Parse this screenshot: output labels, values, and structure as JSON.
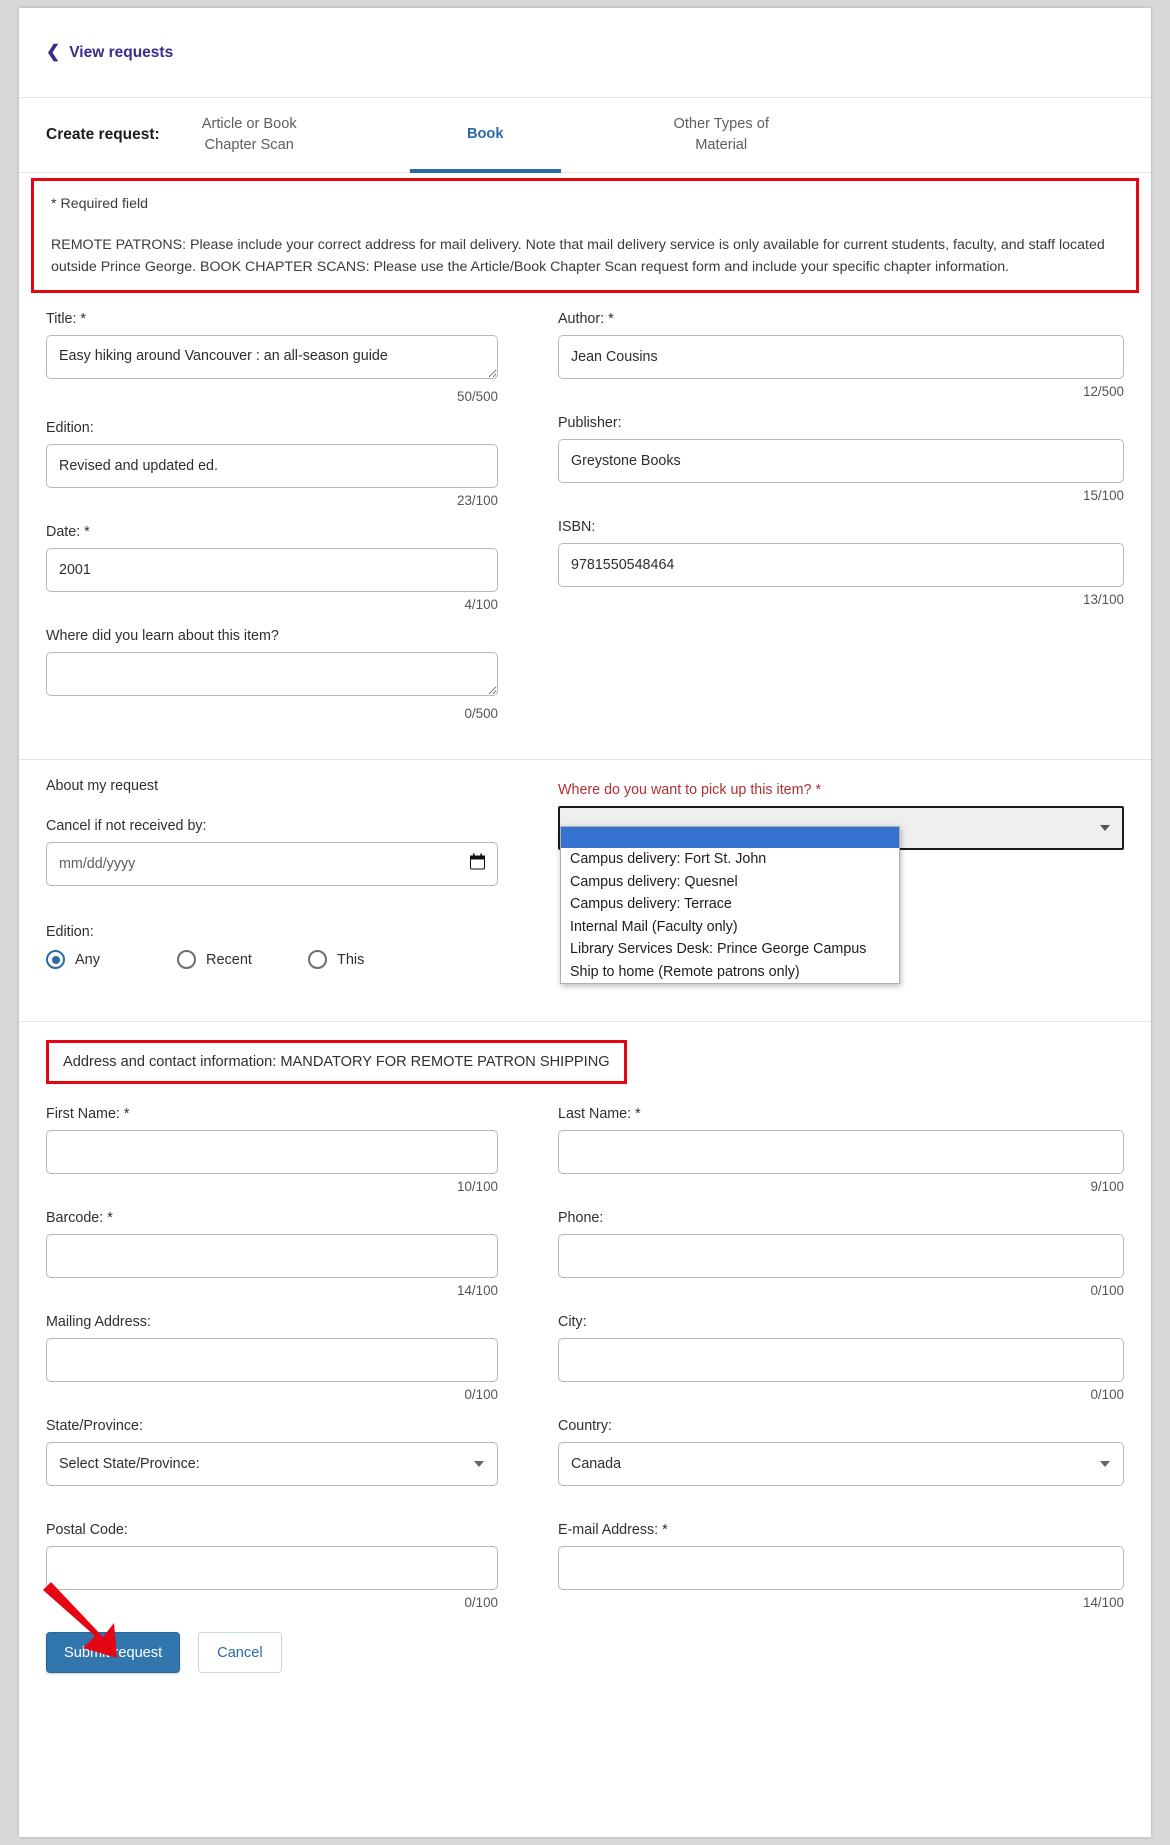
{
  "header": {
    "back_label": "View requests",
    "back_icon": "chevron-left-icon"
  },
  "tabs": {
    "group_label": "Create request:",
    "items": [
      {
        "label": "Article or Book Chapter Scan",
        "active": false
      },
      {
        "label": "Book",
        "active": true
      },
      {
        "label": "Other Types of Material",
        "active": false
      }
    ]
  },
  "notice": {
    "required_note": "* Required field",
    "text": "REMOTE PATRONS: Please include your correct address for mail delivery. Note that mail delivery service is only available for current students, faculty, and staff located outside Prince George. BOOK CHAPTER SCANS: Please use the Article/Book Chapter Scan request form and include your specific chapter information.",
    "border_color": "#e40613"
  },
  "item_details": {
    "title": {
      "label": "Title: *",
      "value": "Easy hiking around Vancouver : an all-season guide",
      "counter": "50/500"
    },
    "author": {
      "label": "Author: *",
      "value": "Jean Cousins",
      "counter": "12/500"
    },
    "edition": {
      "label": "Edition:",
      "value": "Revised and updated ed.",
      "counter": "23/100"
    },
    "publisher": {
      "label": "Publisher:",
      "value": "Greystone Books",
      "counter": "15/100"
    },
    "date": {
      "label": "Date: *",
      "value": "2001",
      "counter": "4/100"
    },
    "isbn": {
      "label": "ISBN:",
      "value": "9781550548464",
      "counter": "13/100"
    },
    "learn_about": {
      "label": "Where did you learn about this item?",
      "value": "",
      "counter": "0/500"
    }
  },
  "about_request": {
    "heading": "About my request",
    "cancel_by": {
      "label": "Cancel if not received by:",
      "placeholder": "mm/dd/yyyy",
      "value": "",
      "icon": "calendar-icon"
    },
    "edition": {
      "label": "Edition:",
      "options": [
        {
          "label": "Any",
          "selected": true
        },
        {
          "label": "Recent",
          "selected": false
        },
        {
          "label": "This",
          "selected": false
        }
      ]
    },
    "pickup": {
      "label": "Where do you want to pick up this item? *",
      "selected_value": "",
      "expanded": true,
      "options": [
        {
          "label": "",
          "highlighted": true
        },
        {
          "label": "Campus delivery: Fort St. John",
          "highlighted": false
        },
        {
          "label": "Campus delivery: Quesnel",
          "highlighted": false
        },
        {
          "label": "Campus delivery: Terrace",
          "highlighted": false
        },
        {
          "label": "Internal Mail (Faculty only)",
          "highlighted": false
        },
        {
          "label": "Library Services Desk: Prince George Campus",
          "highlighted": false
        },
        {
          "label": "Ship to home (Remote patrons only)",
          "highlighted": false
        }
      ]
    }
  },
  "address_section": {
    "heading": "Address and contact information: MANDATORY FOR REMOTE PATRON SHIPPING",
    "first_name": {
      "label": "First Name: *",
      "value": "",
      "counter": "10/100"
    },
    "last_name": {
      "label": "Last Name: *",
      "value": "",
      "counter": "9/100"
    },
    "barcode": {
      "label": "Barcode: *",
      "value": "",
      "counter": "14/100"
    },
    "phone": {
      "label": "Phone:",
      "value": "",
      "counter": "0/100"
    },
    "mailing_address": {
      "label": "Mailing Address:",
      "value": "",
      "counter": "0/100"
    },
    "city": {
      "label": "City:",
      "value": "",
      "counter": "0/100"
    },
    "state": {
      "label": "State/Province:",
      "value": "Select State/Province:"
    },
    "country": {
      "label": "Country:",
      "value": "Canada"
    },
    "postal_code": {
      "label": "Postal Code:",
      "value": "",
      "counter": "0/100"
    },
    "email": {
      "label": "E-mail Address: *",
      "value": "",
      "counter": "14/100"
    }
  },
  "actions": {
    "submit_label": "Submit request",
    "cancel_label": "Cancel",
    "submit_color": "#3176ad",
    "annotation_arrow_color": "#e40613"
  }
}
